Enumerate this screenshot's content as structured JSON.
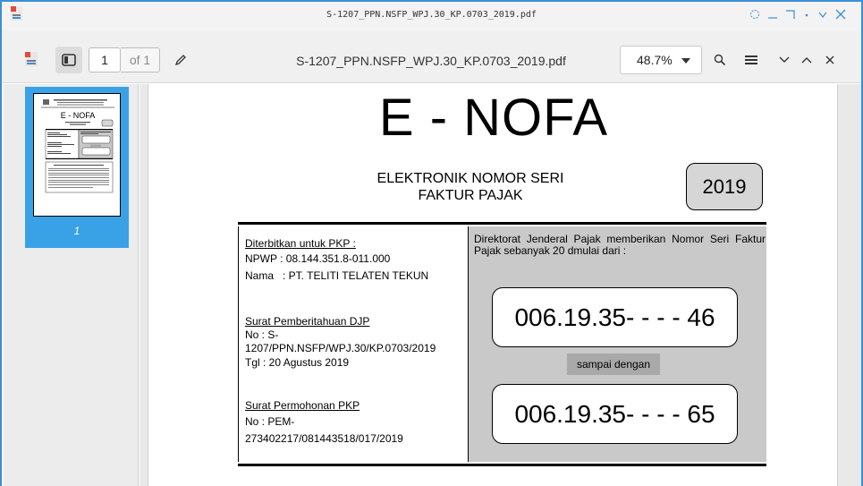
{
  "window": {
    "title": "S-1207_PPN.NSFP_WPJ.30_KP.0703_2019.pdf"
  },
  "toolbar": {
    "page_current": "1",
    "page_total": "of 1",
    "document_title": "S-1207_PPN.NSFP_WPJ.30_KP.0703_2019.pdf",
    "zoom": "48.7%"
  },
  "sidebar": {
    "thumbnails": [
      {
        "page_label": "1"
      }
    ]
  },
  "document": {
    "heading": "E - NOFA",
    "subtitle_line1": "ELEKTRONIK NOMOR SERI",
    "subtitle_line2": "FAKTUR PAJAK",
    "year": "2019",
    "left": {
      "issued_for_label": "Diterbitkan untuk PKP :",
      "npwp": "NPWP : 08.144.351.8-011.000",
      "nama": "Nama   : PT. TELITI TELATEN TEKUN",
      "djp_notice_label": "Surat Pemberitahuan DJP",
      "djp_no_line1": "No : S-",
      "djp_no_line2": "1207/PPN.NSFP/WPJ.30/KP.0703/2019",
      "djp_date": "Tgl : 20 Agustus 2019",
      "request_label": "Surat Permohonan PKP",
      "request_no_line1": "No : PEM-",
      "request_no_line2": "273402217/081443518/017/2019"
    },
    "right": {
      "statement": "Direktorat Jenderal Pajak memberikan Nomor Seri Faktur Pajak sebanyak 20 dmulai dari :",
      "start_number": "006.19.35- - - - 46",
      "until_label": "sampai dengan",
      "end_number": "006.19.35- - - - 65"
    }
  },
  "colors": {
    "accent": "#3b8fd6",
    "selected_thumbnail": "#39a2e6",
    "panel_gray": "#c9c9c9"
  }
}
